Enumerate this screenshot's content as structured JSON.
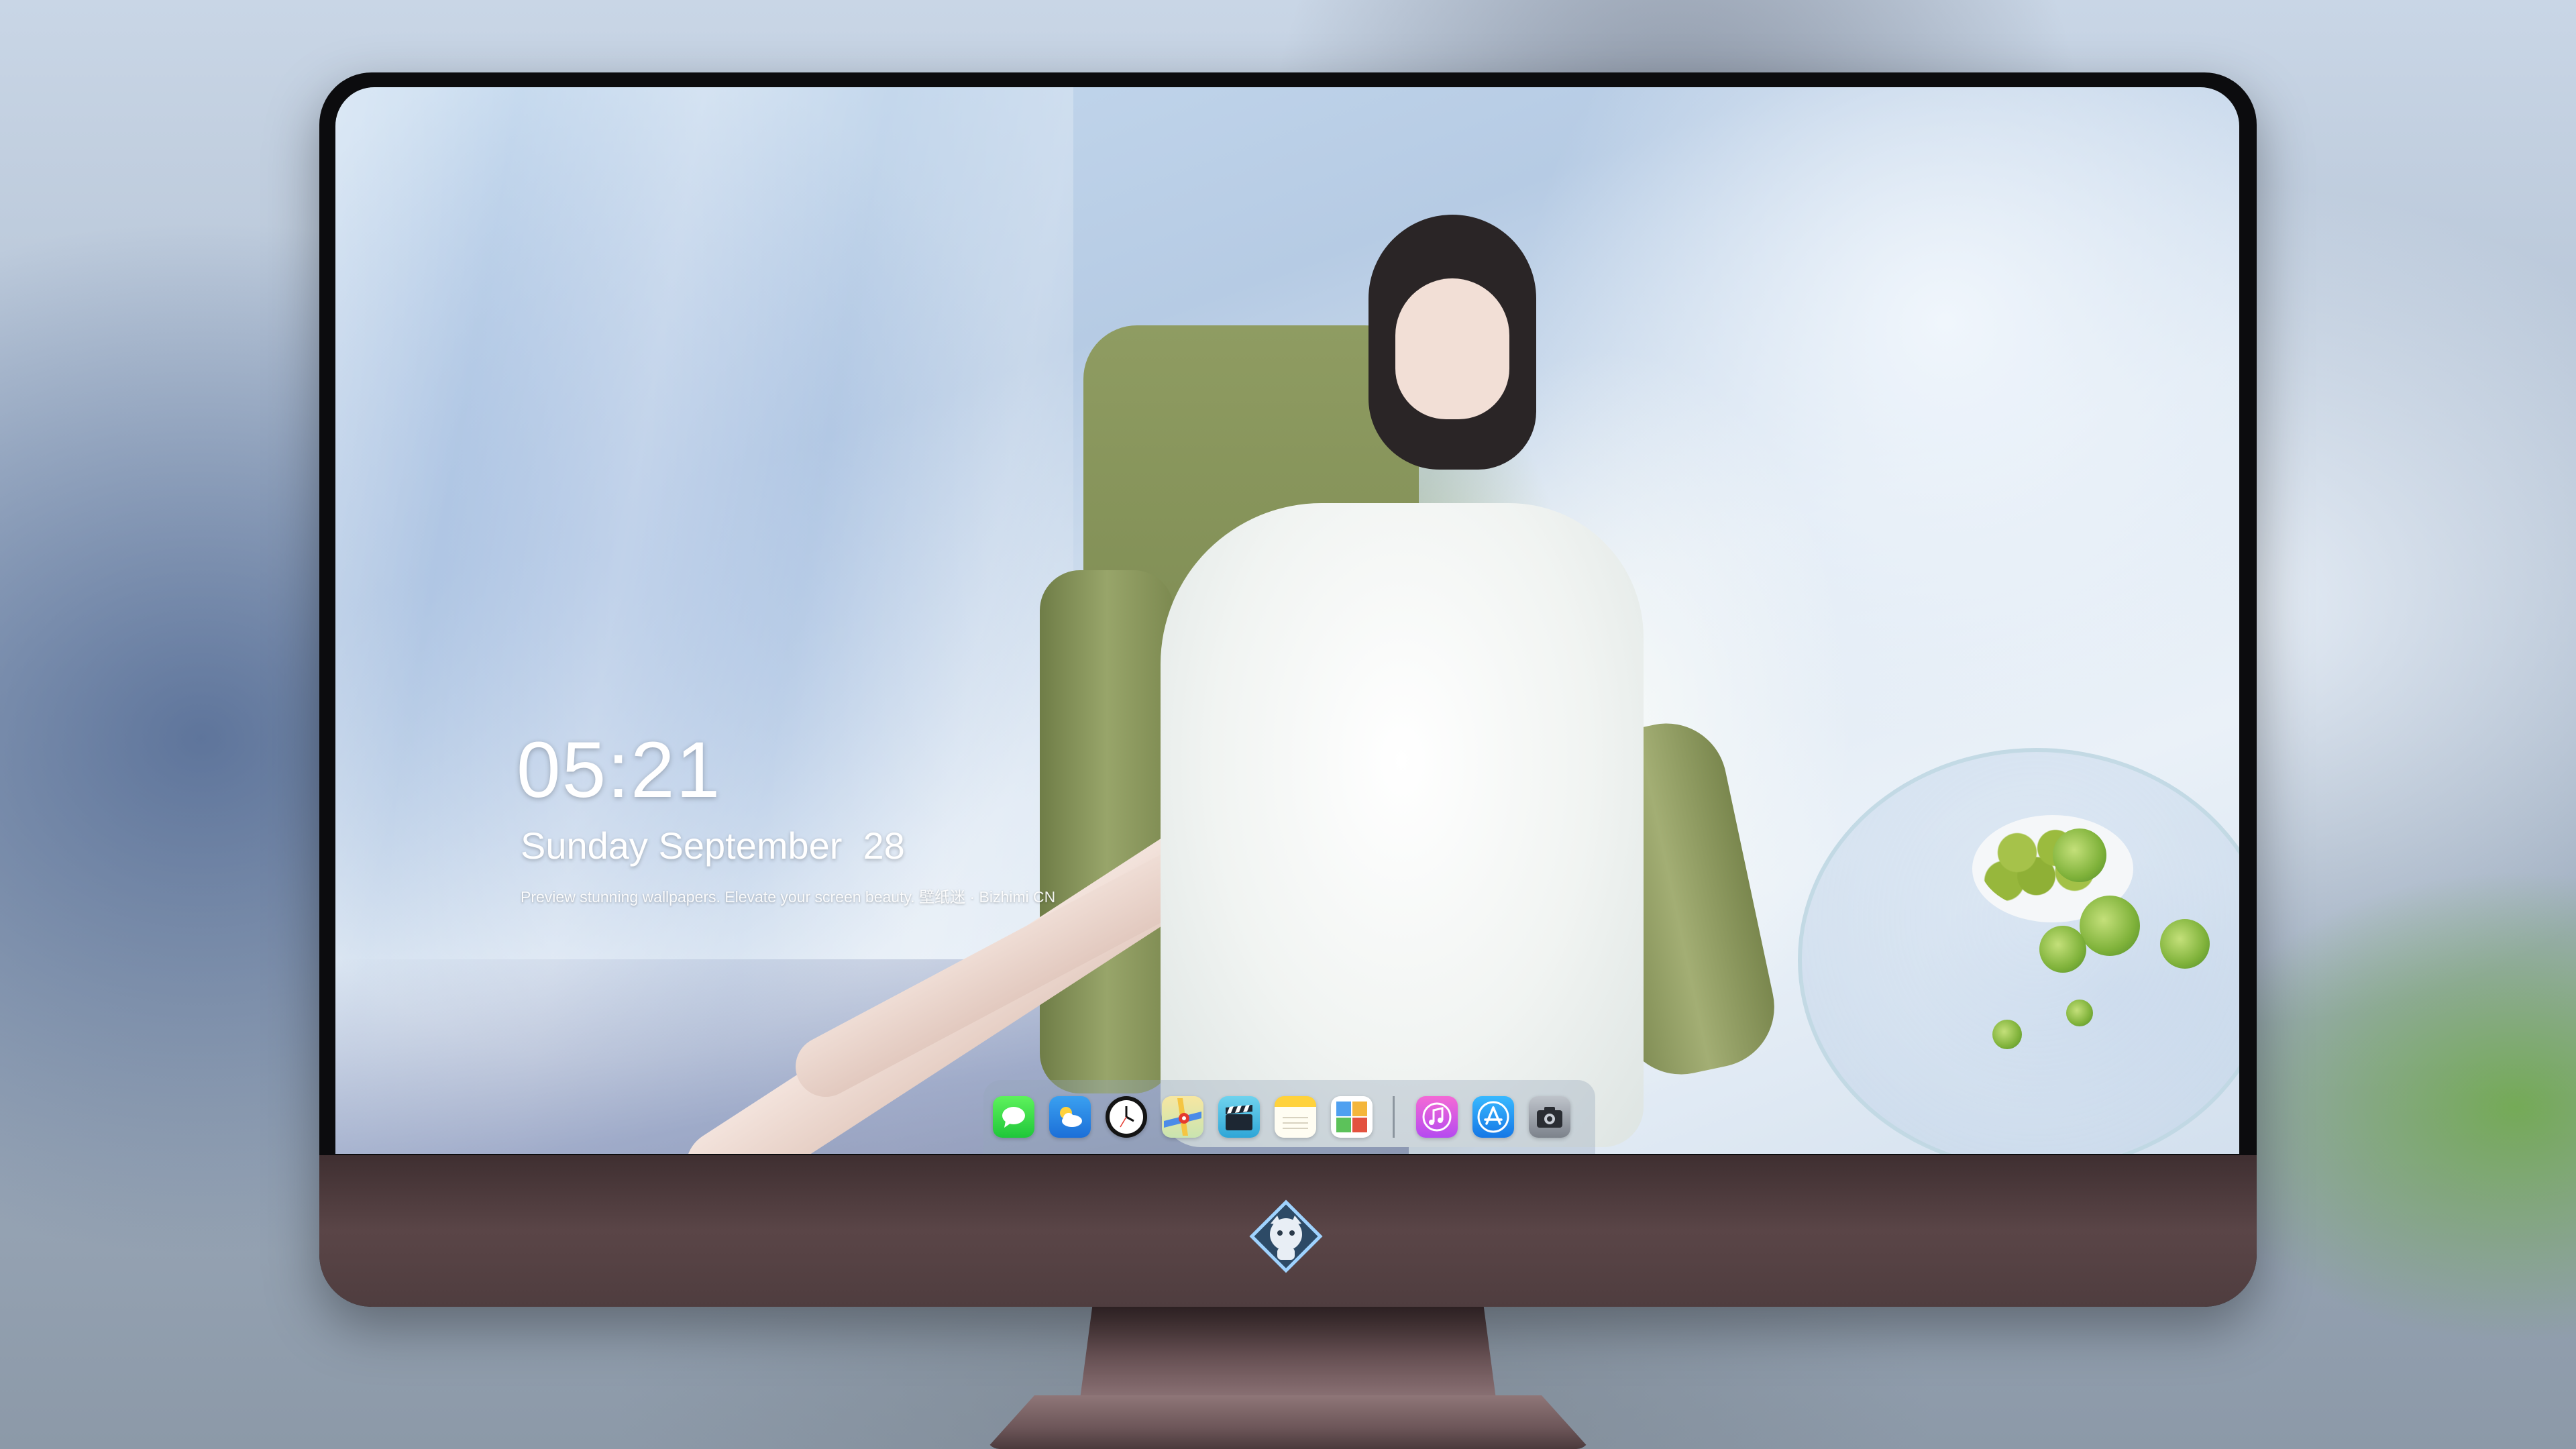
{
  "lock_screen": {
    "time": "05:21",
    "date": "Sunday September  28",
    "tagline": "Preview stunning wallpapers. Elevate your screen beauty. 壁纸迷 · Bizhimi CN"
  },
  "dock": {
    "apps": [
      {
        "name": "Messages",
        "icon": "messages-icon"
      },
      {
        "name": "Weather",
        "icon": "weather-icon"
      },
      {
        "name": "Clock",
        "icon": "clock-icon"
      },
      {
        "name": "Maps",
        "icon": "maps-icon"
      },
      {
        "name": "Videos",
        "icon": "clapperboard-icon"
      },
      {
        "name": "Notes",
        "icon": "notes-icon"
      },
      {
        "name": "Photos",
        "icon": "photos-icon"
      },
      {
        "name": "Music",
        "icon": "music-note-icon"
      },
      {
        "name": "App Store",
        "icon": "app-store-icon"
      },
      {
        "name": "Camera",
        "icon": "camera-icon"
      }
    ]
  },
  "monitor": {
    "logo": "mascot-logo-icon",
    "bezel_color": "#0c0c0e",
    "chin_color": "#4f3d3f"
  }
}
